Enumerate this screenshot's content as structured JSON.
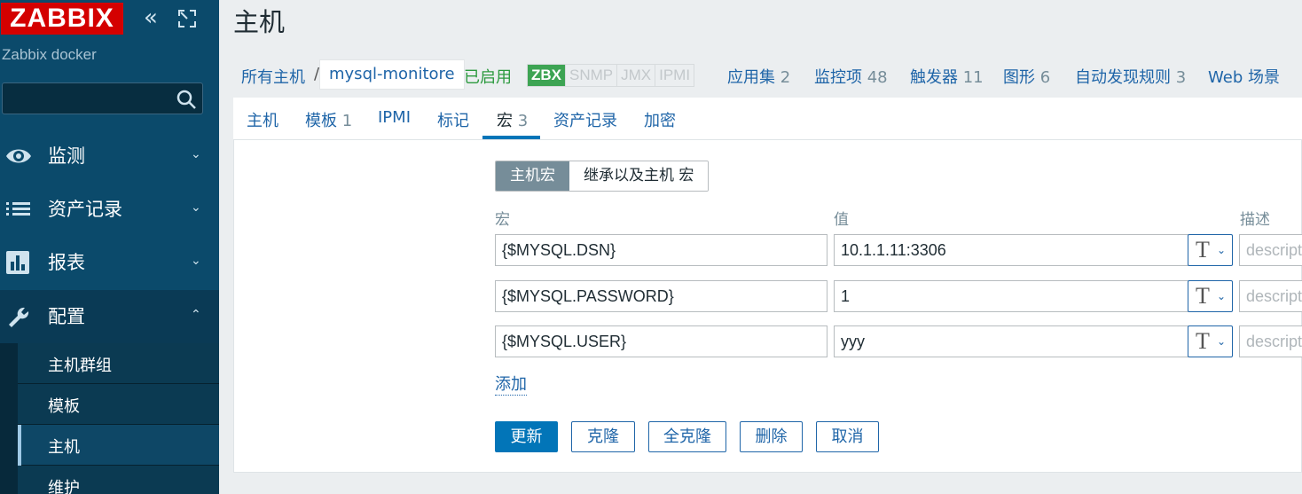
{
  "sidebar": {
    "logo": "ZABBIX",
    "server_name": "Zabbix docker",
    "search": {
      "value": "",
      "placeholder": ""
    },
    "menu": [
      {
        "label": "监测",
        "icon": "eye-icon"
      },
      {
        "label": "资产记录",
        "icon": "list-icon"
      },
      {
        "label": "报表",
        "icon": "bar-chart-icon"
      },
      {
        "label": "配置",
        "icon": "wrench-icon"
      }
    ],
    "submenu": [
      "主机群组",
      "模板",
      "主机",
      "维护"
    ]
  },
  "page": {
    "title": "主机"
  },
  "hostbar": {
    "all_hosts": "所有主机",
    "separator": "/",
    "host": "mysql-monitore",
    "status": "已启用",
    "availability": [
      "ZBX",
      "SNMP",
      "JMX",
      "IPMI"
    ],
    "links": [
      {
        "label": "应用集",
        "count": "2"
      },
      {
        "label": "监控项",
        "count": "48"
      },
      {
        "label": "触发器",
        "count": "11"
      },
      {
        "label": "图形",
        "count": "6"
      },
      {
        "label": "自动发现规则",
        "count": "3"
      },
      {
        "label": "Web 场景",
        "count": ""
      }
    ]
  },
  "tabs": [
    {
      "label": "主机",
      "count": ""
    },
    {
      "label": "模板",
      "count": "1"
    },
    {
      "label": "IPMI",
      "count": ""
    },
    {
      "label": "标记",
      "count": ""
    },
    {
      "label": "宏",
      "count": "3"
    },
    {
      "label": "资产记录",
      "count": ""
    },
    {
      "label": "加密",
      "count": ""
    }
  ],
  "macro_view": {
    "host_macros": "主机宏",
    "inherited": "继承以及主机 宏"
  },
  "columns": {
    "macro": "宏",
    "value": "值",
    "description": "描述"
  },
  "macros": [
    {
      "macro": "{$MYSQL.DSN}",
      "value": "10.1.1.11:3306",
      "description_placeholder": "description"
    },
    {
      "macro": "{$MYSQL.PASSWORD}",
      "value": "1",
      "description_placeholder": "description"
    },
    {
      "macro": "{$MYSQL.USER}",
      "value": "yyy",
      "description_placeholder": "description"
    }
  ],
  "add_label": "添加",
  "type_glyph": "T",
  "buttons": {
    "update": "更新",
    "clone": "克隆",
    "full_clone": "全克隆",
    "delete": "删除",
    "cancel": "取消"
  }
}
